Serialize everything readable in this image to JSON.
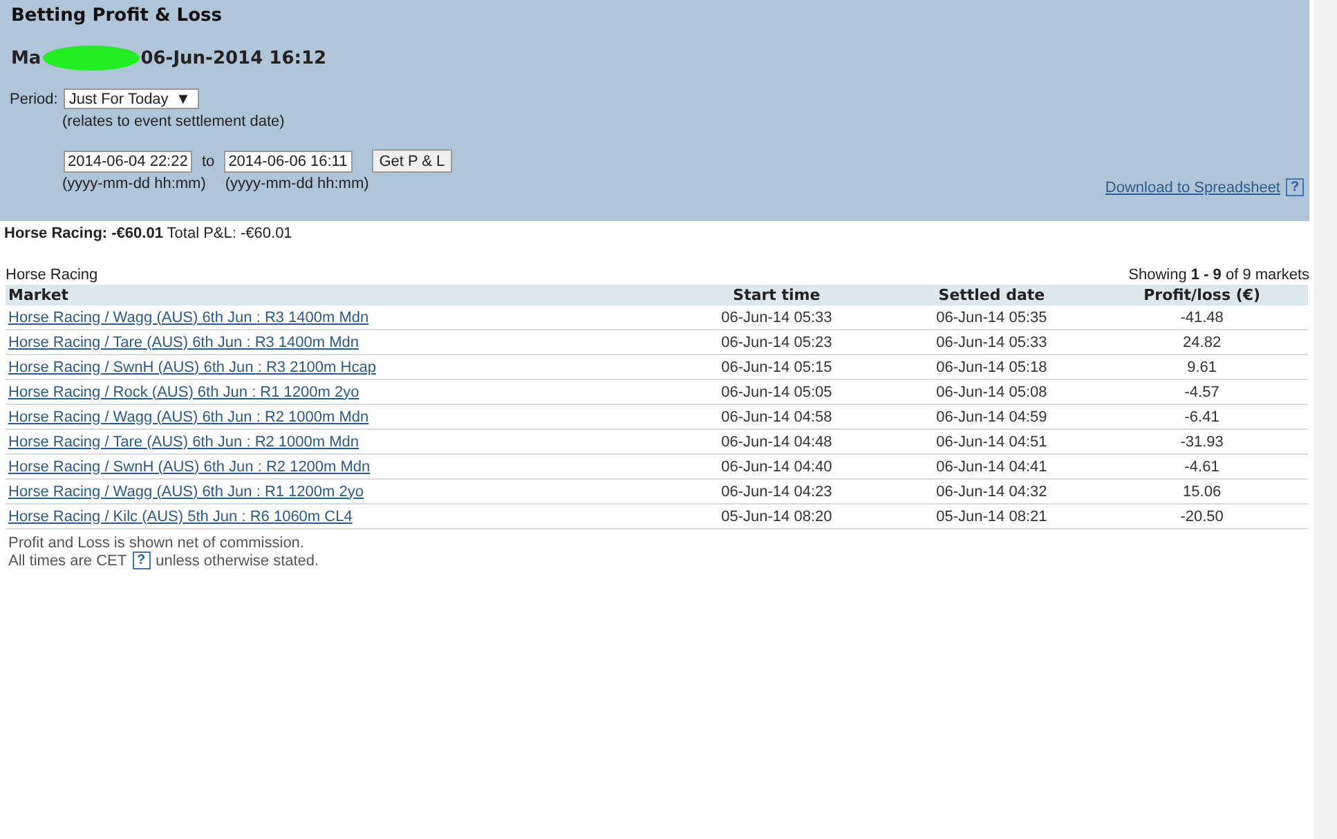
{
  "title": "Betting Profit & Loss",
  "account_line": {
    "prefix": "Ma",
    "date": "06-Jun-2014 16:12"
  },
  "period": {
    "label": "Period:",
    "value": "Just For Today",
    "arrow": "▼",
    "note": "(relates to event settlement date)"
  },
  "range": {
    "from": "2014-06-04 22:22",
    "to_label": "to",
    "to": "2014-06-06 16:11",
    "button": "Get P & L",
    "from_hint": "(yyyy-mm-dd hh:mm)",
    "to_hint": "(yyyy-mm-dd hh:mm)"
  },
  "download": {
    "label": "Download to Spreadsheet",
    "help": "?"
  },
  "summary": "**Horse Racing: -€60.01**  Total P&L:  -€60.01",
  "section_title": "Horse Racing",
  "showing": "Showing **1 - 9** of 9 markets",
  "table": {
    "columns": [
      "Market",
      "Start time",
      "Settled date",
      "Profit/loss (€)"
    ],
    "rows": [
      [
        "Horse Racing / Wagg (AUS) 6th Jun : R3 1400m Mdn",
        "06-Jun-14 05:33",
        "06-Jun-14 05:35",
        "-41.48"
      ],
      [
        "Horse Racing / Tare (AUS) 6th Jun : R3 1400m Mdn",
        "06-Jun-14 05:23",
        "06-Jun-14 05:33",
        "24.82"
      ],
      [
        "Horse Racing / SwnH (AUS) 6th Jun : R3 2100m Hcap",
        "06-Jun-14 05:15",
        "06-Jun-14 05:18",
        "9.61"
      ],
      [
        "Horse Racing / Rock (AUS) 6th Jun : R1 1200m 2yo",
        "06-Jun-14 05:05",
        "06-Jun-14 05:08",
        "-4.57"
      ],
      [
        "Horse Racing / Wagg (AUS) 6th Jun : R2 1000m Mdn",
        "06-Jun-14 04:58",
        "06-Jun-14 04:59",
        "-6.41"
      ],
      [
        "Horse Racing / Tare (AUS) 6th Jun : R2 1000m Mdn",
        "06-Jun-14 04:48",
        "06-Jun-14 04:51",
        "-31.93"
      ],
      [
        "Horse Racing / SwnH (AUS) 6th Jun : R2 1200m Mdn",
        "06-Jun-14 04:40",
        "06-Jun-14 04:41",
        "-4.61"
      ],
      [
        "Horse Racing / Wagg (AUS) 6th Jun : R1 1200m 2yo",
        "06-Jun-14 04:23",
        "06-Jun-14 04:32",
        "15.06"
      ],
      [
        "Horse Racing / Kilc (AUS) 5th Jun : R6 1060m CL4",
        "05-Jun-14 08:20",
        "05-Jun-14 08:21",
        "-20.50"
      ]
    ]
  },
  "footer": {
    "line1": "Profit and Loss is shown net of commission.",
    "line2_before": "All times are CET",
    "help": "?",
    "line2_after": "unless otherwise stated."
  }
}
